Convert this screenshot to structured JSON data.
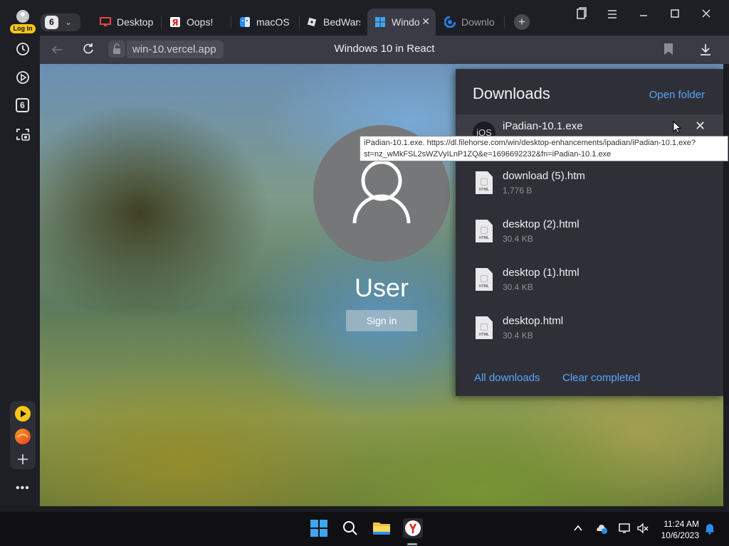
{
  "profile": {
    "login_label": "Log in"
  },
  "tab_switcher": {
    "count": "6"
  },
  "tabs": [
    {
      "label": "Desktop",
      "icon": "monitor-icon"
    },
    {
      "label": "Oops!",
      "icon": "yandex-icon"
    },
    {
      "label": "macOS in",
      "icon": "finder-icon"
    },
    {
      "label": "BedWars",
      "icon": "roblox-icon"
    },
    {
      "label": "Windo",
      "icon": "windows-icon",
      "active": true
    },
    {
      "label": "Downlo",
      "icon": "filehorse-icon"
    }
  ],
  "sidebar": {
    "tab_count": "6",
    "more": "•••"
  },
  "addressbar": {
    "url": "win-10.vercel.app",
    "page_title": "Windows 10 in React"
  },
  "login_screen": {
    "username": "User",
    "signin_label": "Sign in"
  },
  "downloads": {
    "heading": "Downloads",
    "open_folder": "Open folder",
    "items": [
      {
        "name": "iPadian-10.1.exe",
        "size": "",
        "icon": "ios-icon"
      },
      {
        "name": "download (5).htm",
        "size": "1,776 B",
        "icon": "html-file-icon"
      },
      {
        "name": "desktop (2).html",
        "size": "30.4 KB",
        "icon": "html-file-icon"
      },
      {
        "name": "desktop (1).html",
        "size": "30.4 KB",
        "icon": "html-file-icon"
      },
      {
        "name": "desktop.html",
        "size": "30.4 KB",
        "icon": "html-file-icon"
      }
    ],
    "all_downloads": "All downloads",
    "clear_completed": "Clear completed",
    "tooltip_line1": "iPadian-10.1.exe. https://dl.filehorse.com/win/desktop-enhancements/ipadian/iPadian-10.1.exe?",
    "tooltip_line2": "st=nz_wMkFSL2sWZVyILnP1ZQ&e=1696692232&fn=iPadian-10.1.exe"
  },
  "taskbar": {
    "time": "11:24 AM",
    "date": "10/6/2023"
  },
  "colors": {
    "accent_link": "#5aa3ff",
    "login_badge": "#f6c71b",
    "panel_bg": "#2f3037"
  }
}
